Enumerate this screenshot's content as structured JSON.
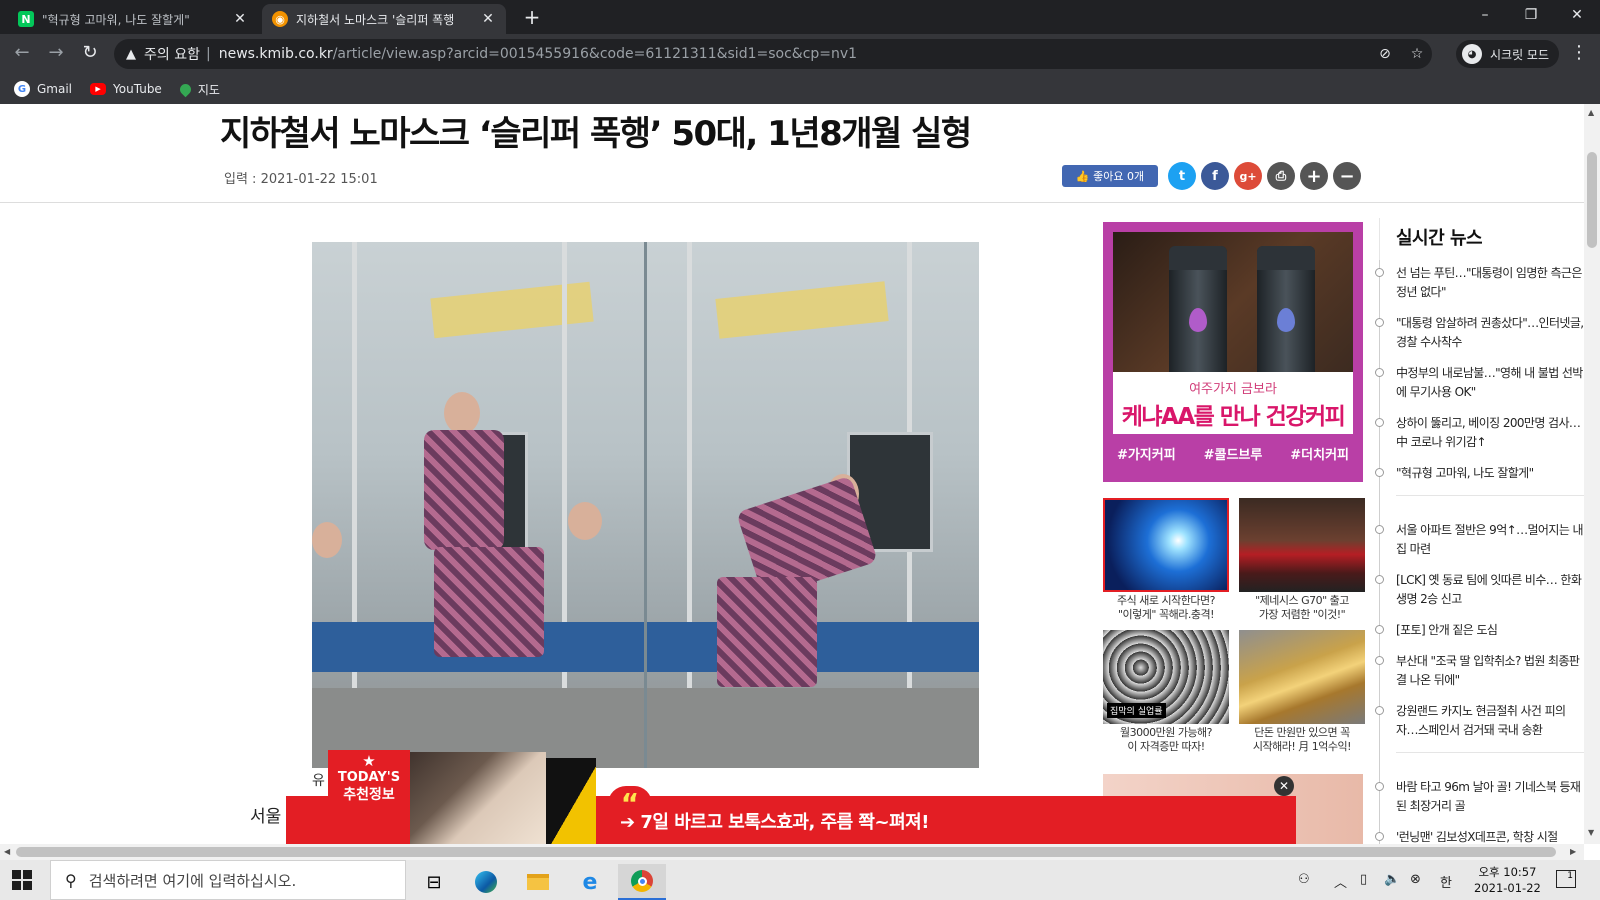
{
  "browser": {
    "tabs": [
      {
        "title": "\"혁규형 고마워, 나도 잘할게\"",
        "favicon": "naver-n",
        "favicon_color": "#03c75a",
        "active": false
      },
      {
        "title": "지하철서 노마스크 '슬리퍼 폭행",
        "favicon": "kmib-logo",
        "favicon_color": "#f29200",
        "active": true
      }
    ],
    "new_tab_label": "+",
    "window_controls": [
      "–",
      "❐",
      "✕"
    ],
    "omnibox": {
      "security_warning": "주의 요함",
      "separator": "|",
      "host": "news.kmib.co.kr",
      "path": "/article/view.asp?arcid=0015455916&code=61121311&sid1=soc&cp=nv1"
    },
    "incognito_label": "시크릿 모드",
    "bookmarks": [
      {
        "label": "Gmail",
        "icon": "google-icon"
      },
      {
        "label": "YouTube",
        "icon": "youtube-icon"
      },
      {
        "label": "지도",
        "icon": "maps-pin-icon"
      }
    ]
  },
  "article": {
    "headline": "지하철서 노마스크 ‘슬리퍼 폭행’ 50대, 1년8개월 실형",
    "date": "입력 : 2021-01-22 15:01",
    "like_label": "👍 좋아요 0개",
    "share_buttons": [
      {
        "name": "twitter",
        "glyph": "t",
        "color": "#1da1f2"
      },
      {
        "name": "facebook",
        "glyph": "f",
        "color": "#3b5998"
      },
      {
        "name": "google-plus",
        "glyph": "g+",
        "color": "#dd4b39"
      },
      {
        "name": "print",
        "glyph": "⎙",
        "color": "#555555"
      },
      {
        "name": "font-increase",
        "glyph": "+",
        "color": "#555555"
      },
      {
        "name": "font-decrease",
        "glyph": "−",
        "color": "#555555"
      }
    ],
    "photo_caption_start": "유",
    "body_start": "서울"
  },
  "side_ad": {
    "subtitle": "여주가지 금보라",
    "main": "케냐AA를 만나 건강커피",
    "tags": [
      "#가지커피",
      "#콜드브루",
      "#더치커피"
    ]
  },
  "thumb_ads": [
    {
      "caption_1": "주식 새로 시작한다면?",
      "caption_2": "\"이렇게\" 꼭해라.충격!"
    },
    {
      "caption_1": "\"제네시스 G70\" 출고",
      "caption_2": "가장 저렴한 \"이것!\""
    },
    {
      "caption_1": "월3000만원 가능해?",
      "caption_2": "이 자격증만 따자!",
      "overlay": "집막의 실업률"
    },
    {
      "caption_1": "단돈 만원만 있으면 꼭",
      "caption_2": "시작해라! 月 1억수익!"
    }
  ],
  "realtime": {
    "title": "실시간 뉴스",
    "items": [
      "선 넘는 푸틴…\"대통령이 임명한 측근은 정년 없다\"",
      "\"대통령 암살하려 권총샀다\"…인터넷글, 경찰 수사착수",
      "中정부의 내로남불…\"영해 내 불법 선박에 무기사용 OK\"",
      "상하이 뚫리고, 베이징 200만명 검사…中 코로나 위기감↑",
      "\"혁규형 고마워, 나도 잘할게\"",
      "서울 아파트 절반은 9억↑…멀어지는 내집 마련",
      "[LCK] 옛 동료 팀에 잇따른 비수… 한화생명 2승 신고",
      "[포토] 안개 짙은 도심",
      "부산대 \"조국 딸 입학취소? 법원 최종판결 나온 뒤에\"",
      "강원랜드 카지노 현금절취 사건 피의자…스페인서 검거돼 국내 송환",
      "바람 타고 96m 날아 골! 기네스북 등재된 최장거리 골",
      "'런닝맨' 김보성X데프콘, 학창 시절"
    ]
  },
  "floating_ad": {
    "badge_line1": "TODAY'S",
    "badge_line2": "추천정보",
    "quote_mark": "“",
    "text": "➔ 7일 바르고 보톡스효과, 주름 쫙~펴져!"
  },
  "taskbar": {
    "search_placeholder": "검색하려면 여기에 입력하십시오.",
    "ime": "한",
    "time": "오후 10:57",
    "date": "2021-01-22",
    "notification_count": "1"
  }
}
